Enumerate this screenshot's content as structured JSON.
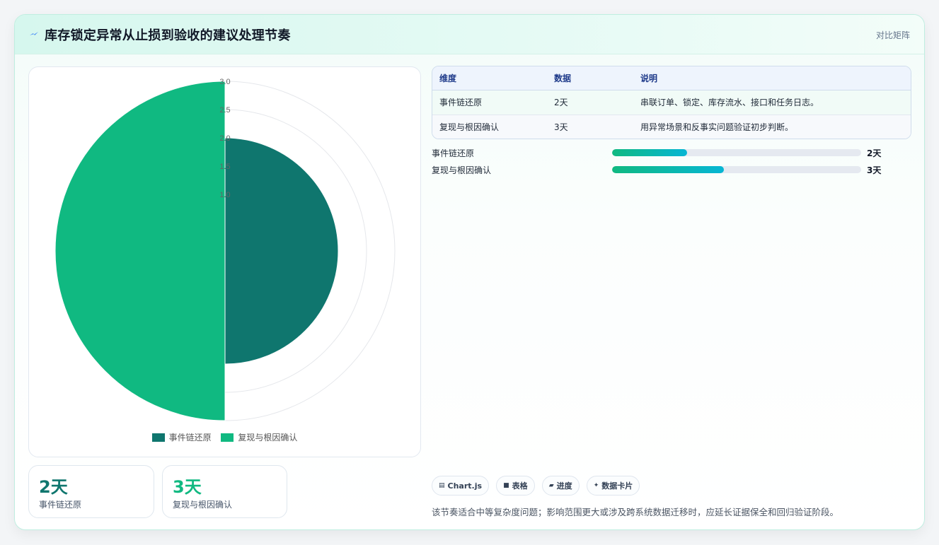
{
  "header": {
    "title": "库存锁定异常从止损到验收的建议处理节奏",
    "tag": "对比矩阵",
    "icon": "bolt-icon"
  },
  "chart_data": {
    "type": "polarArea",
    "categories": [
      "事件链还原",
      "复现与根因确认"
    ],
    "values": [
      2,
      3
    ],
    "colors": [
      "#0f766e",
      "#10b981"
    ],
    "rlim": [
      0,
      3
    ],
    "r_ticks": [
      "1.0",
      "1.5",
      "2.0",
      "2.5",
      "3.0"
    ],
    "legend_position": "bottom"
  },
  "stats": [
    {
      "value": "2天",
      "label": "事件链还原",
      "color": "#0f766e"
    },
    {
      "value": "3天",
      "label": "复现与根因确认",
      "color": "#10b981"
    }
  ],
  "table": {
    "headers": [
      "维度",
      "数据",
      "说明"
    ],
    "rows": [
      [
        "事件链还原",
        "2天",
        "串联订单、锁定、库存流水、接口和任务日志。"
      ],
      [
        "复现与根因确认",
        "3天",
        "用异常场景和反事实问题验证初步判断。"
      ]
    ]
  },
  "progress": [
    {
      "label": "事件链还原",
      "value": "2天",
      "fraction": 0.3
    },
    {
      "label": "复现与根因确认",
      "value": "3天",
      "fraction": 0.45
    }
  ],
  "chips": [
    {
      "icon": "chart-icon",
      "glyph": "▤",
      "label": "Chart.js"
    },
    {
      "icon": "table-icon",
      "glyph": "■",
      "label": "表格"
    },
    {
      "icon": "progress-icon",
      "glyph": "▰",
      "label": "进度"
    },
    {
      "icon": "sparkle-icon",
      "glyph": "✦",
      "label": "数据卡片"
    }
  ],
  "note": "该节奏适合中等复杂度问题；影响范围更大或涉及跨系统数据迁移时，应延长证据保全和回归验证阶段。"
}
